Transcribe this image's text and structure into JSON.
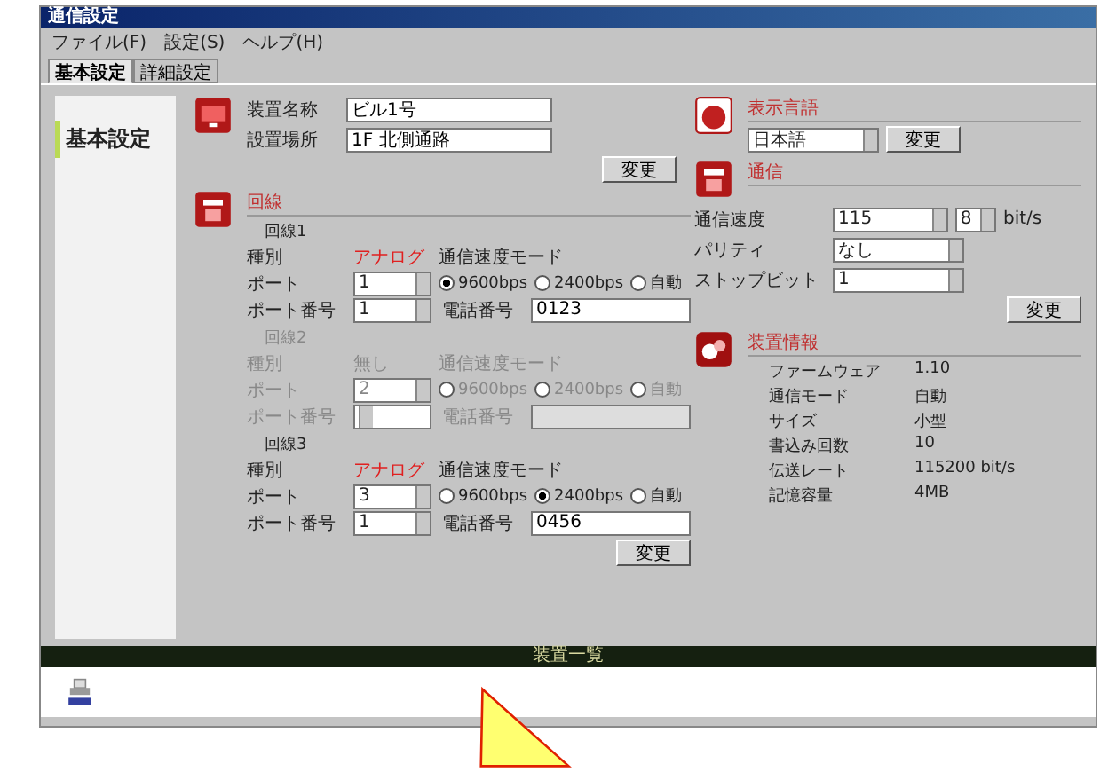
{
  "window": {
    "title": "通信設定"
  },
  "menu": [
    "ファイル(F)",
    "設定(S)",
    "ヘルプ(H)"
  ],
  "tabs": [
    {
      "label": "基本設定",
      "selected": true
    },
    {
      "label": "詳細設定",
      "selected": false
    }
  ],
  "sidebar": {
    "items": [
      {
        "label": "基本設定",
        "selected": true
      }
    ]
  },
  "device": {
    "fields": [
      {
        "label": "装置名称",
        "value": "ビル1号"
      },
      {
        "label": "設置場所",
        "value": "1F 北側通路"
      }
    ],
    "button": "変更"
  },
  "lines": {
    "title": "回線",
    "groups": [
      {
        "title": "回線1",
        "disabled": false,
        "type_label": "種別",
        "type_value": "アナログ",
        "type_alert": true,
        "port_label": "ポート",
        "port": "1",
        "portno_label": "ポート番号",
        "portno": "1",
        "mode_label": "通信速度モード",
        "modes": [
          {
            "label": "9600bps",
            "selected": true
          },
          {
            "label": "2400bps",
            "selected": false
          },
          {
            "label": "自動",
            "selected": false
          }
        ],
        "phone_label": "電話番号",
        "phone": "0123"
      },
      {
        "title": "回線2",
        "disabled": true,
        "type_label": "種別",
        "type_value": "無し",
        "type_alert": false,
        "port_label": "ポート",
        "port": "2",
        "portno_label": "ポート番号",
        "mode_label": "通信速度モード",
        "modes": [
          {
            "label": "9600bps",
            "selected": false
          },
          {
            "label": "2400bps",
            "selected": false
          },
          {
            "label": "自動",
            "selected": false
          }
        ],
        "phone_label": "電話番号"
      },
      {
        "title": "回線3",
        "disabled": false,
        "type_label": "種別",
        "type_value": "アナログ",
        "type_alert": true,
        "port_label": "ポート",
        "port": "3",
        "portno_label": "ポート番号",
        "portno": "1",
        "mode_label": "通信速度モード",
        "modes": [
          {
            "label": "9600bps",
            "selected": false
          },
          {
            "label": "2400bps",
            "selected": true
          },
          {
            "label": "自動",
            "selected": false
          }
        ],
        "phone_label": "電話番号",
        "phone": "0456"
      }
    ],
    "button": "変更"
  },
  "language": {
    "title": "表示言語",
    "value": "日本語",
    "button": "変更"
  },
  "comm": {
    "title": "通信",
    "rows": [
      {
        "label": "通信速度",
        "value": "115"
      },
      {
        "label": "パリティ",
        "value": "なし"
      },
      {
        "label": "ストップビット",
        "value": "1"
      }
    ],
    "extra_value": "8",
    "unit": "bit/s",
    "button": "変更"
  },
  "info": {
    "title": "装置情報",
    "rows": [
      {
        "label": "ファームウェア",
        "value": "1.10"
      },
      {
        "label": "通信モード",
        "value": "自動"
      },
      {
        "label": "サイズ",
        "value": "小型"
      },
      {
        "label": "書込み回数",
        "value": "10"
      },
      {
        "label": "伝送レート",
        "value": "115200 bit/s"
      },
      {
        "label": "記憶容量",
        "value": "4MB"
      }
    ]
  },
  "bottom_bar": {
    "title": "装置一覧"
  }
}
